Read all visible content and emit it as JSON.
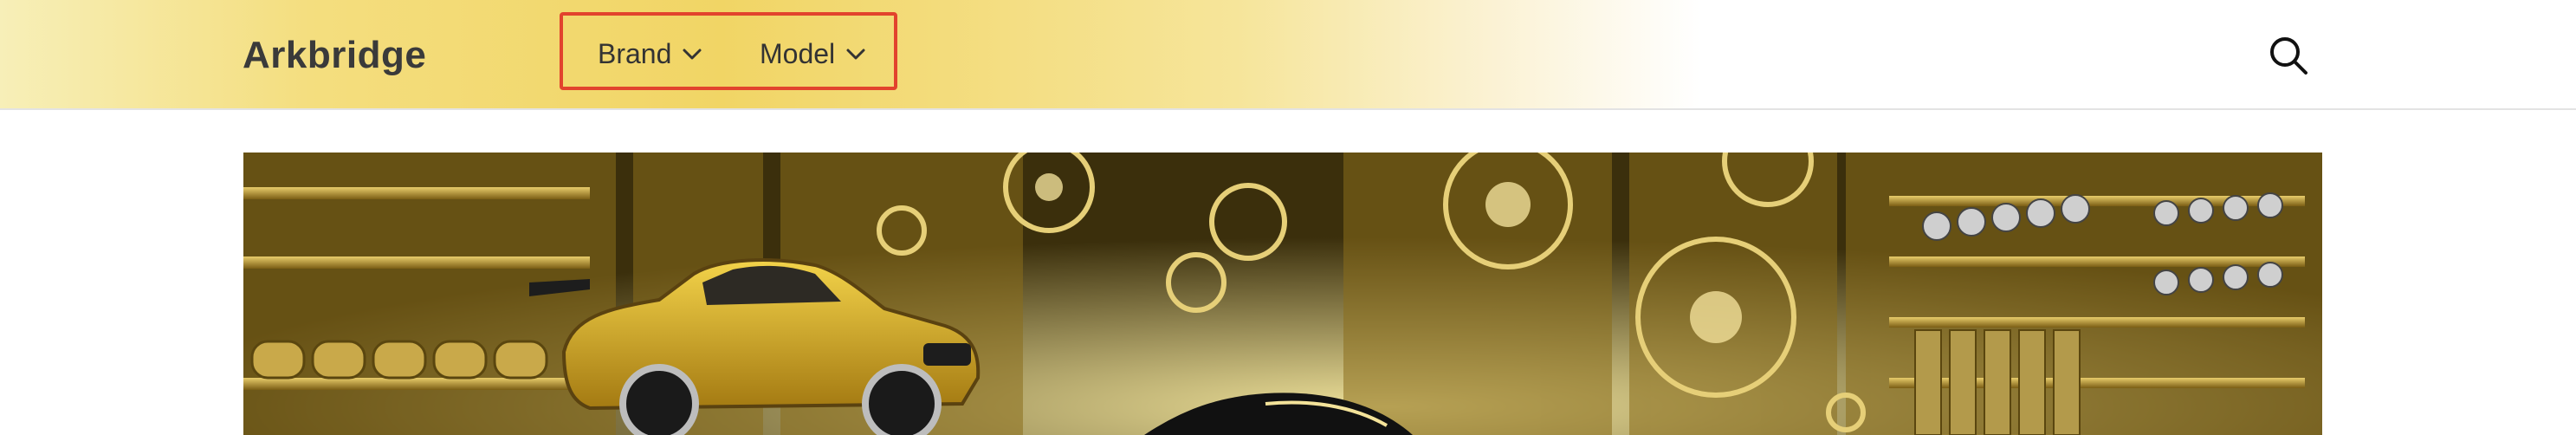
{
  "header": {
    "logo_text": "Arkbridge",
    "nav": [
      {
        "label": "Brand"
      },
      {
        "label": "Model"
      }
    ],
    "search_icon": "search-icon",
    "highlight_color": "#e2432d"
  },
  "hero": {
    "description_icon": "hero-banner-image"
  },
  "colors": {
    "header_gold": "#f1d565",
    "text_dark": "#333333"
  }
}
